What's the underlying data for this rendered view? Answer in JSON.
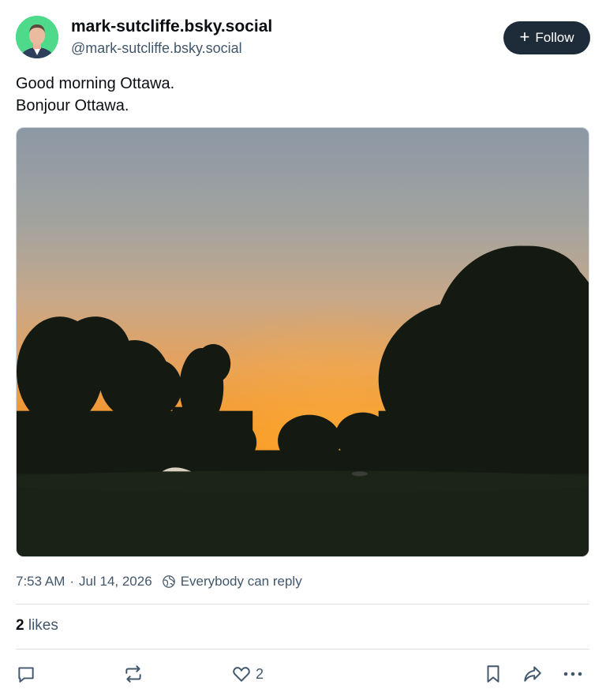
{
  "author": {
    "display_name": "mark-sutcliffe.bsky.social",
    "handle": "@mark-sutcliffe.bsky.social",
    "avatar_icon": "person-avatar"
  },
  "follow_button": {
    "label": "Follow",
    "icon": "plus-icon"
  },
  "post": {
    "text": "Good morning Ottawa.\nBonjour Ottawa.",
    "image": "sunset-over-trees-photo"
  },
  "meta": {
    "time": "7:53 AM",
    "separator": "·",
    "date": "Jul 14, 2026",
    "reply_setting": "Everybody can reply",
    "reply_icon": "globe-icon"
  },
  "stats": {
    "likes_count": "2",
    "likes_label": "likes"
  },
  "actions": {
    "reply_icon": "comment-icon",
    "repost_icon": "repost-icon",
    "like_icon": "heart-icon",
    "like_count": "2",
    "bookmark_icon": "bookmark-icon",
    "share_icon": "share-icon",
    "more_icon": "more-icon"
  },
  "colors": {
    "follow_bg": "#1e2b38",
    "muted_text": "#42576c",
    "avatar_bg": "#4fd98a",
    "sky_top": "#8d99a6",
    "sunset_orange": "#f2951e"
  }
}
